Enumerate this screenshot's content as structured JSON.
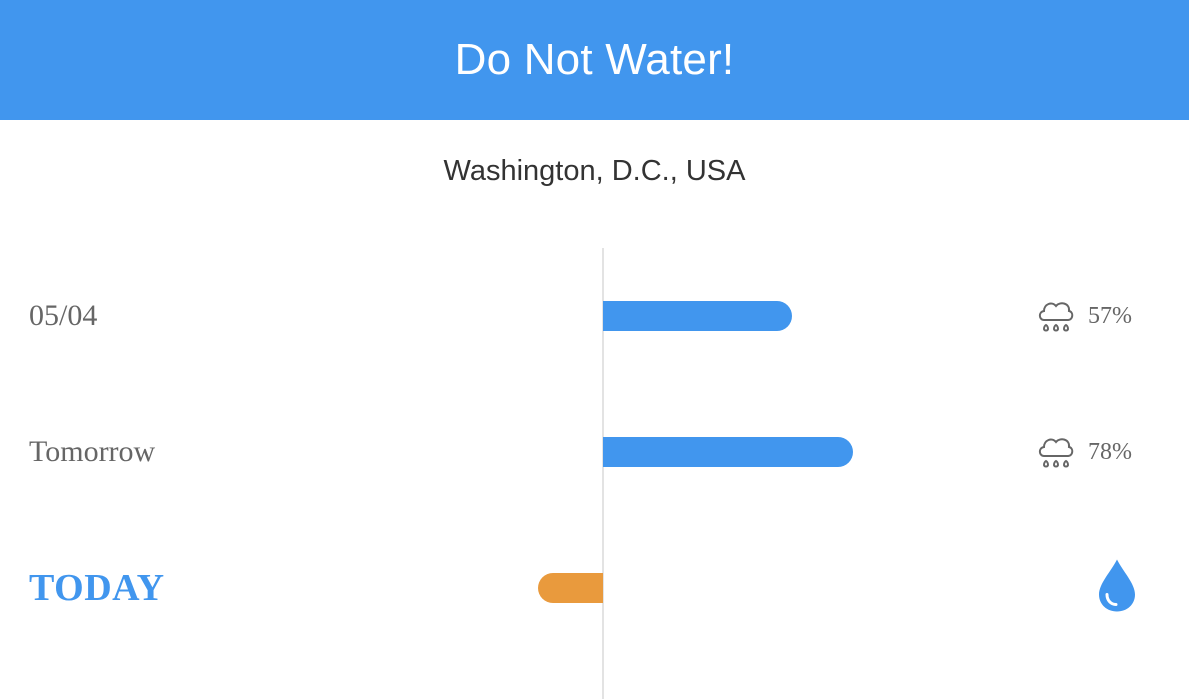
{
  "header": {
    "title": "Do Not Water!"
  },
  "location": "Washington, D.C., USA",
  "colors": {
    "accent": "#4196ee",
    "today_bar": "#e99a3d",
    "text": "#666666"
  },
  "rows": [
    {
      "label": "05/04",
      "rain_probability_pct": "57%",
      "icon": "rain-cloud-icon",
      "bar_value": 0.49,
      "bar_direction": "positive"
    },
    {
      "label": "Tomorrow",
      "rain_probability_pct": "78%",
      "icon": "rain-cloud-icon",
      "bar_value": 0.65,
      "bar_direction": "positive"
    },
    {
      "label": "TODAY",
      "icon": "water-drop-icon",
      "bar_value": 0.17,
      "bar_direction": "negative"
    }
  ]
}
